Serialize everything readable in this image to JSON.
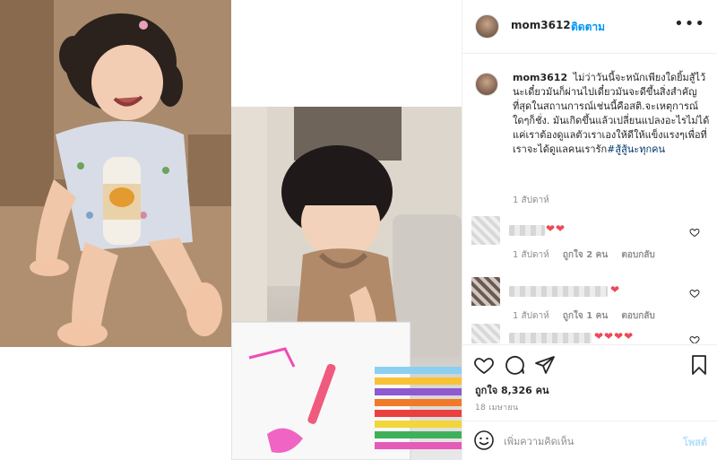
{
  "post": {
    "username": "mom3612",
    "follow_label": "ติดตาม",
    "more_icon": "more-options-icon",
    "caption": "ไม่ว่าวันนี้จะหนักเพียงใดยิ้มสู้ไว้นะเดี๋ยวมันก็ผ่านไปเดี๋ยวมันจะดีขึ้นสิ่งสำคัญที่สุดในสถานการณ์เช่นนี้คือสติ.จะเหตุการณ์ใดๆก็ชั่ง. มันเกิดขึ้นแล้วเปลี่ยนแปลงอะไรไม่ได้แค่เราต้องดูแลตัวเราเองให้ดีให้แข็งแรงๆเพื่อที่เราจะได้ดูแลคนเรารัก",
    "hashtag": "#สู้สู้นะทุกคน",
    "caption_time": "1 สัปดาห์",
    "likes": "ถูกใจ 8,326 คน",
    "date": "18 เมษายน",
    "comment_placeholder": "เพิ่มความคิดเห็น",
    "post_label": "โพสต์"
  },
  "comments": [
    {
      "hearts": "❤❤",
      "time": "1 สัปดาห์",
      "likes": "ถูกใจ 2 คน",
      "reply": "ตอบกลับ"
    },
    {
      "hearts": "❤",
      "time": "1 สัปดาห์",
      "likes": "ถูกใจ 1 คน",
      "reply": "ตอบกลับ"
    },
    {
      "hearts": "❤❤❤❤",
      "time": "",
      "likes": "",
      "reply": ""
    }
  ],
  "icons": {
    "like": "heart-icon",
    "comment": "comment-icon",
    "share": "share-icon",
    "save": "bookmark-icon",
    "emoji": "emoji-icon"
  },
  "colors": {
    "link": "#0095f6",
    "heart": "#ed4956",
    "muted": "#8e8e8e"
  }
}
